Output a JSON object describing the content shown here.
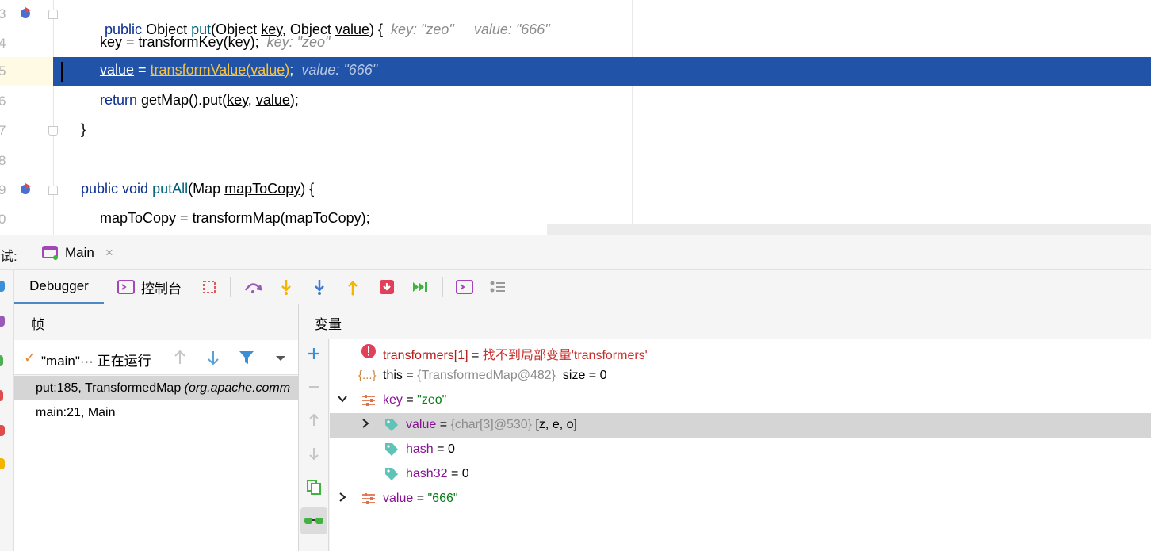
{
  "editor": {
    "lines": [
      {
        "num": "3",
        "hint1": "key: \"zeo\"",
        "hint2": "value: \"666\""
      },
      {
        "num": "4",
        "hint": "key: \"zeo\""
      },
      {
        "num": "5",
        "hint": "value: \"666\""
      },
      {
        "num": "6"
      },
      {
        "num": "7"
      },
      {
        "num": "8"
      },
      {
        "num": "9"
      },
      {
        "num": "0"
      }
    ],
    "tokens": {
      "public": "public",
      "object_type": "Object",
      "put": "put",
      "key": "key",
      "value": "value",
      "transformKey": "transformKey",
      "transformValue": "transformValue",
      "return": "return",
      "getMap": "getMap",
      "void": "void",
      "putAll": "putAll",
      "map_type": "Map",
      "mapToCopy": "mapToCopy",
      "transformMap": "transformMap"
    }
  },
  "debug": {
    "window_label": "试:",
    "run_tab": "Main",
    "debugger_tab": "Debugger",
    "console_tab": "控制台",
    "frames_header": "帧",
    "variables_header": "变量",
    "thread": {
      "name": "\"main\"",
      "ellipsis": "···",
      "status": "正在运行"
    },
    "frames": [
      {
        "method": "put:185, TransformedMap",
        "package": "(org.apache.comm"
      },
      {
        "method": "main:21, Main",
        "package": ""
      }
    ],
    "variables": {
      "error_row": {
        "name": "transformers[1]",
        "eq": " = ",
        "msg": "找不到局部变量'transformers'"
      },
      "this_row": {
        "icon_label": "{...}",
        "name": "this",
        "eq": " = ",
        "ref": "{TransformedMap@482}",
        "extra": "  size = 0"
      },
      "key_row": {
        "name": "key",
        "eq": " = ",
        "val": "\"zeo\""
      },
      "key_value_row": {
        "name": "value",
        "eq": " = ",
        "ref": "{char[3]@530}",
        "extra": " [z, e, o]"
      },
      "hash_row": {
        "name": "hash",
        "eq": " = ",
        "val": "0"
      },
      "hash32_row": {
        "name": "hash32",
        "eq": " = ",
        "val": "0"
      },
      "value_row": {
        "name": "value",
        "eq": " = ",
        "val": "\"666\""
      }
    }
  },
  "colors": {
    "selection": "#2154a8",
    "keyword": "#0d2f8d",
    "method": "#00627a",
    "field": "#871094",
    "string": "#067d17",
    "hint": "#8c8c8c",
    "warning_method": "#f6c343"
  }
}
